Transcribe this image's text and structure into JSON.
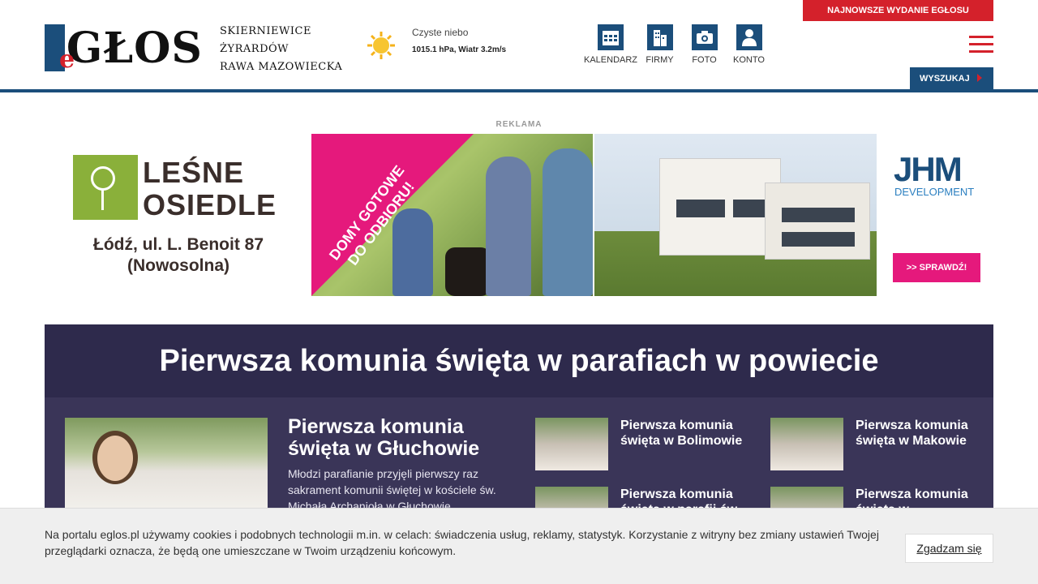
{
  "header": {
    "logo_text": "GŁOS",
    "logo_prefix": "e",
    "regions": [
      "SKIERNIEWICE",
      "ŻYRARDÓW",
      "RAWA MAZOWIECKA"
    ],
    "weather": {
      "condition": "Czyste niebo",
      "details": "1015.1 hPa, Wiatr 3.2m/s",
      "icon": "sun-icon"
    },
    "nav": [
      {
        "label": "KALENDARZ",
        "icon": "calendar-icon"
      },
      {
        "label": "FIRMY",
        "icon": "building-icon"
      },
      {
        "label": "FOTO",
        "icon": "camera-icon"
      },
      {
        "label": "KONTO",
        "icon": "user-icon"
      }
    ],
    "latest_issue_label": "NAJNOWSZE WYDANIE EGŁOSU",
    "search_label": "WYSZUKAJ"
  },
  "ad": {
    "label": "REKLAMA",
    "left_brand_line1": "LEŚNE",
    "left_brand_line2": "OSIEDLE",
    "left_address_line1": "Łódź, ul. L. Benoit 87",
    "left_address_line2": "(Nowosolna)",
    "promo_text": "DOMY GOTOWE DO ODBIORU!",
    "right_brand": "JHM",
    "right_sub": "DEVELOPMENT",
    "right_cta": ">> SPRAWDŹ!"
  },
  "feature": {
    "title": "Pierwsza komunia święta w parafiach w powiecie",
    "main_article": {
      "title": "Pierwsza komunia święta w Głuchowie",
      "excerpt": "Młodzi parafianie przyjęli pierwszy raz sakrament komunii świętej w kościele św. Michała Archanioła w Głuchowie"
    },
    "side_articles": [
      {
        "title": "Pierwsza komunia święta w Bolimowie"
      },
      {
        "title": "Pierwsza komunia święta w Makowie"
      },
      {
        "title": "Pierwsza komunia święta w parafii św."
      },
      {
        "title": "Pierwsza komunia święta w"
      }
    ]
  },
  "cookie": {
    "text": "Na portalu eglos.pl używamy cookies i podobnych technologii m.in. w celach: świadczenia usług, reklamy, statystyk. Korzystanie z witryny bez zmiany ustawień Twojej przeglądarki oznacza, że będą one umieszczane w Twoim urządzeniu końcowym.",
    "accept_label": "Zgadzam się"
  },
  "colors": {
    "brand_blue": "#1b4e7b",
    "accent_red": "#d4212b",
    "feature_bg": "#3a3558",
    "ad_pink": "#e5197c"
  }
}
